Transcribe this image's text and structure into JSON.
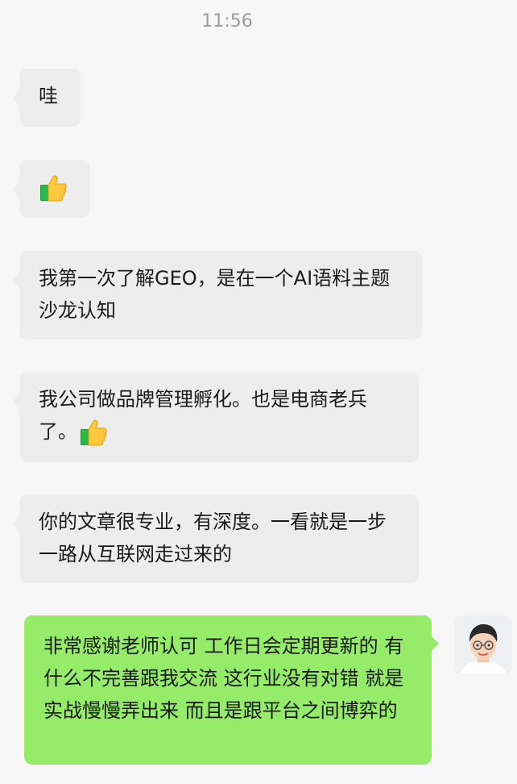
{
  "status": {
    "time": "11:56"
  },
  "messages": [
    {
      "text": "哇"
    },
    {
      "text": ""
    },
    {
      "text": "我第一次了解GEO，是在一个AI语料主题沙龙认知"
    },
    {
      "text": "我公司做品牌管理孵化。也是电商老兵了。"
    },
    {
      "text": "你的文章很专业，有深度。一看就是一步一路从互联网走过来的"
    },
    {
      "text": "非常感谢老师认可 工作日会定期更新的 有什么不完善跟我交流 这行业没有对错 就是实战慢慢弄出来  而且是跟平台之间博弈的"
    }
  ],
  "emoji": {
    "thumbs_up": "thumbs-up-icon"
  },
  "colors": {
    "incoming_bubble": "#ededed",
    "outgoing_bubble": "#95ec69",
    "background": "#f7f7f7"
  }
}
